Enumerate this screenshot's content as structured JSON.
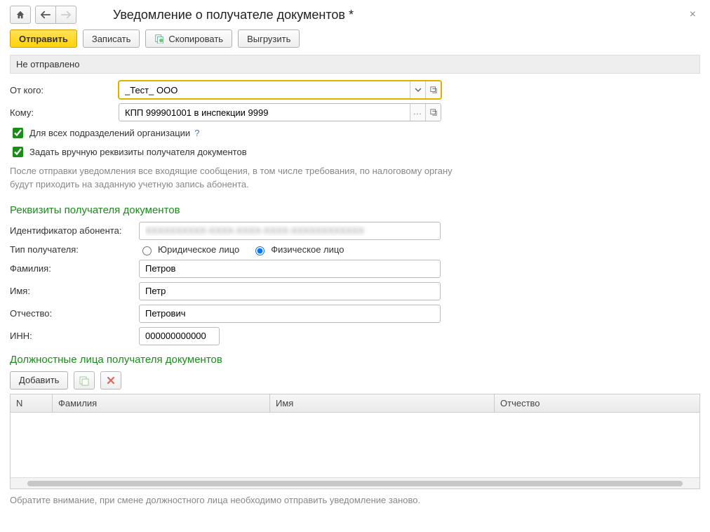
{
  "title": "Уведомление о получателе документов *",
  "toolbar": {
    "send": "Отправить",
    "save": "Записать",
    "copy": "Скопировать",
    "export": "Выгрузить"
  },
  "status": "Не отправлено",
  "labels": {
    "from": "От кого:",
    "to": "Кому:"
  },
  "fields": {
    "from": "_Тест_ ООО",
    "to": "КПП 999901001 в инспекции 9999"
  },
  "checks": {
    "all_branches": "Для всех подразделений организации",
    "manual_requisites": "Задать вручную реквизиты получателя документов"
  },
  "help_q": "?",
  "info_text": "После отправки уведомления все входящие сообщения, в том числе требования, по налоговому органу будут приходить на заданную учетную запись абонента.",
  "section1": {
    "title": "Реквизиты получателя документов",
    "abonent_label": "Идентификатор абонента:",
    "abonent_value": "XXXXXXXXXX-XXXX-XXXX-XXXX-XXXXXXXXXXXX",
    "recipient_type_label": "Тип получателя:",
    "radio_legal": "Юридическое лицо",
    "radio_person": "Физическое лицо",
    "lastname_label": "Фамилия:",
    "lastname": "Петров",
    "firstname_label": "Имя:",
    "firstname": "Петр",
    "patronymic_label": "Отчество:",
    "patronymic": "Петрович",
    "inn_label": "ИНН:",
    "inn": "000000000000"
  },
  "section2": {
    "title": "Должностные лица получателя документов",
    "add": "Добавить",
    "cols": {
      "n": "N",
      "f": "Фамилия",
      "i": "Имя",
      "o": "Отчество"
    }
  },
  "footer_note": "Обратите внимание, при смене должностного лица необходимо отправить уведомление заново."
}
